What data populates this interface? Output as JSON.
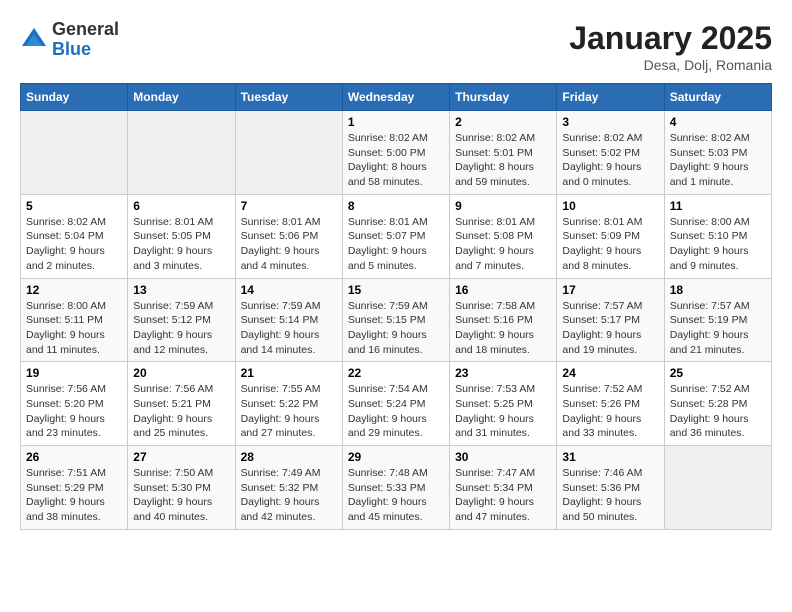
{
  "header": {
    "logo_general": "General",
    "logo_blue": "Blue",
    "month": "January 2025",
    "location": "Desa, Dolj, Romania"
  },
  "days_of_week": [
    "Sunday",
    "Monday",
    "Tuesday",
    "Wednesday",
    "Thursday",
    "Friday",
    "Saturday"
  ],
  "weeks": [
    [
      {
        "day": "",
        "info": ""
      },
      {
        "day": "",
        "info": ""
      },
      {
        "day": "",
        "info": ""
      },
      {
        "day": "1",
        "info": "Sunrise: 8:02 AM\nSunset: 5:00 PM\nDaylight: 8 hours\nand 58 minutes."
      },
      {
        "day": "2",
        "info": "Sunrise: 8:02 AM\nSunset: 5:01 PM\nDaylight: 8 hours\nand 59 minutes."
      },
      {
        "day": "3",
        "info": "Sunrise: 8:02 AM\nSunset: 5:02 PM\nDaylight: 9 hours\nand 0 minutes."
      },
      {
        "day": "4",
        "info": "Sunrise: 8:02 AM\nSunset: 5:03 PM\nDaylight: 9 hours\nand 1 minute."
      }
    ],
    [
      {
        "day": "5",
        "info": "Sunrise: 8:02 AM\nSunset: 5:04 PM\nDaylight: 9 hours\nand 2 minutes."
      },
      {
        "day": "6",
        "info": "Sunrise: 8:01 AM\nSunset: 5:05 PM\nDaylight: 9 hours\nand 3 minutes."
      },
      {
        "day": "7",
        "info": "Sunrise: 8:01 AM\nSunset: 5:06 PM\nDaylight: 9 hours\nand 4 minutes."
      },
      {
        "day": "8",
        "info": "Sunrise: 8:01 AM\nSunset: 5:07 PM\nDaylight: 9 hours\nand 5 minutes."
      },
      {
        "day": "9",
        "info": "Sunrise: 8:01 AM\nSunset: 5:08 PM\nDaylight: 9 hours\nand 7 minutes."
      },
      {
        "day": "10",
        "info": "Sunrise: 8:01 AM\nSunset: 5:09 PM\nDaylight: 9 hours\nand 8 minutes."
      },
      {
        "day": "11",
        "info": "Sunrise: 8:00 AM\nSunset: 5:10 PM\nDaylight: 9 hours\nand 9 minutes."
      }
    ],
    [
      {
        "day": "12",
        "info": "Sunrise: 8:00 AM\nSunset: 5:11 PM\nDaylight: 9 hours\nand 11 minutes."
      },
      {
        "day": "13",
        "info": "Sunrise: 7:59 AM\nSunset: 5:12 PM\nDaylight: 9 hours\nand 12 minutes."
      },
      {
        "day": "14",
        "info": "Sunrise: 7:59 AM\nSunset: 5:14 PM\nDaylight: 9 hours\nand 14 minutes."
      },
      {
        "day": "15",
        "info": "Sunrise: 7:59 AM\nSunset: 5:15 PM\nDaylight: 9 hours\nand 16 minutes."
      },
      {
        "day": "16",
        "info": "Sunrise: 7:58 AM\nSunset: 5:16 PM\nDaylight: 9 hours\nand 18 minutes."
      },
      {
        "day": "17",
        "info": "Sunrise: 7:57 AM\nSunset: 5:17 PM\nDaylight: 9 hours\nand 19 minutes."
      },
      {
        "day": "18",
        "info": "Sunrise: 7:57 AM\nSunset: 5:19 PM\nDaylight: 9 hours\nand 21 minutes."
      }
    ],
    [
      {
        "day": "19",
        "info": "Sunrise: 7:56 AM\nSunset: 5:20 PM\nDaylight: 9 hours\nand 23 minutes."
      },
      {
        "day": "20",
        "info": "Sunrise: 7:56 AM\nSunset: 5:21 PM\nDaylight: 9 hours\nand 25 minutes."
      },
      {
        "day": "21",
        "info": "Sunrise: 7:55 AM\nSunset: 5:22 PM\nDaylight: 9 hours\nand 27 minutes."
      },
      {
        "day": "22",
        "info": "Sunrise: 7:54 AM\nSunset: 5:24 PM\nDaylight: 9 hours\nand 29 minutes."
      },
      {
        "day": "23",
        "info": "Sunrise: 7:53 AM\nSunset: 5:25 PM\nDaylight: 9 hours\nand 31 minutes."
      },
      {
        "day": "24",
        "info": "Sunrise: 7:52 AM\nSunset: 5:26 PM\nDaylight: 9 hours\nand 33 minutes."
      },
      {
        "day": "25",
        "info": "Sunrise: 7:52 AM\nSunset: 5:28 PM\nDaylight: 9 hours\nand 36 minutes."
      }
    ],
    [
      {
        "day": "26",
        "info": "Sunrise: 7:51 AM\nSunset: 5:29 PM\nDaylight: 9 hours\nand 38 minutes."
      },
      {
        "day": "27",
        "info": "Sunrise: 7:50 AM\nSunset: 5:30 PM\nDaylight: 9 hours\nand 40 minutes."
      },
      {
        "day": "28",
        "info": "Sunrise: 7:49 AM\nSunset: 5:32 PM\nDaylight: 9 hours\nand 42 minutes."
      },
      {
        "day": "29",
        "info": "Sunrise: 7:48 AM\nSunset: 5:33 PM\nDaylight: 9 hours\nand 45 minutes."
      },
      {
        "day": "30",
        "info": "Sunrise: 7:47 AM\nSunset: 5:34 PM\nDaylight: 9 hours\nand 47 minutes."
      },
      {
        "day": "31",
        "info": "Sunrise: 7:46 AM\nSunset: 5:36 PM\nDaylight: 9 hours\nand 50 minutes."
      },
      {
        "day": "",
        "info": ""
      }
    ]
  ]
}
